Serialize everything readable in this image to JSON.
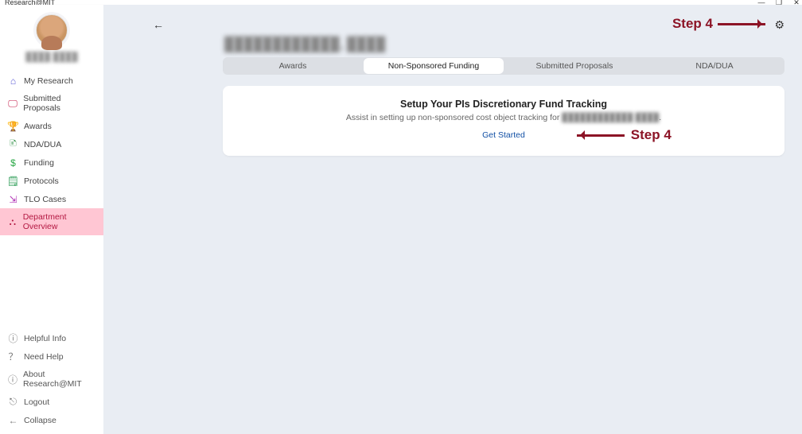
{
  "app_title": "Research@MIT",
  "user_name": "████ ████",
  "nav": [
    {
      "label": "My Research",
      "iconClass": "ic-home",
      "name": "home"
    },
    {
      "label": "Submitted Proposals",
      "iconClass": "ic-prop",
      "name": "submitted-proposals"
    },
    {
      "label": "Awards",
      "iconClass": "ic-award",
      "name": "awards"
    },
    {
      "label": "NDA/DUA",
      "iconClass": "ic-nda",
      "name": "nda-dua"
    },
    {
      "label": "Funding",
      "iconClass": "ic-fund",
      "name": "funding"
    },
    {
      "label": "Protocols",
      "iconClass": "ic-proto",
      "name": "protocols"
    },
    {
      "label": "TLO Cases",
      "iconClass": "ic-tlo",
      "name": "tlo-cases"
    },
    {
      "label": "Department Overview",
      "iconClass": "ic-dept",
      "name": "department-overview",
      "active": true
    }
  ],
  "footer_nav": [
    {
      "label": "Helpful Info",
      "name": "helpful-info"
    },
    {
      "label": "Need Help",
      "name": "need-help"
    },
    {
      "label": "About Research@MIT",
      "name": "about"
    },
    {
      "label": "Logout",
      "name": "logout",
      "iconClass": "ic-logout"
    },
    {
      "label": "Collapse",
      "name": "collapse"
    }
  ],
  "pi_name": "████████████, ████",
  "tabs": [
    {
      "label": "Awards"
    },
    {
      "label": "Non-Sponsored Funding",
      "active": true
    },
    {
      "label": "Submitted Proposals"
    },
    {
      "label": "NDA/DUA"
    }
  ],
  "panel": {
    "title": "Setup Your PIs Discretionary Fund Tracking",
    "subtitle_prefix": "Assist in setting up non-sponsored cost object tracking for ",
    "subtitle_blur": "████████████ ████",
    "cta": "Get Started"
  },
  "annotation": "Step 4",
  "icons": {
    "home": "⌂",
    "submitted-proposals": "🖵",
    "awards": "🏆",
    "nda-dua": "🗈",
    "funding": "$",
    "protocols": "🗒",
    "tlo-cases": "⇲",
    "department-overview": "⛬",
    "helpful-info": "ⓘ",
    "need-help": "？",
    "about": "ⓘ",
    "logout": "⎋",
    "collapse": "←",
    "back": "←",
    "gear": "⚙"
  },
  "window_controls": {
    "min": "—",
    "max": "❐",
    "close": "✕"
  }
}
